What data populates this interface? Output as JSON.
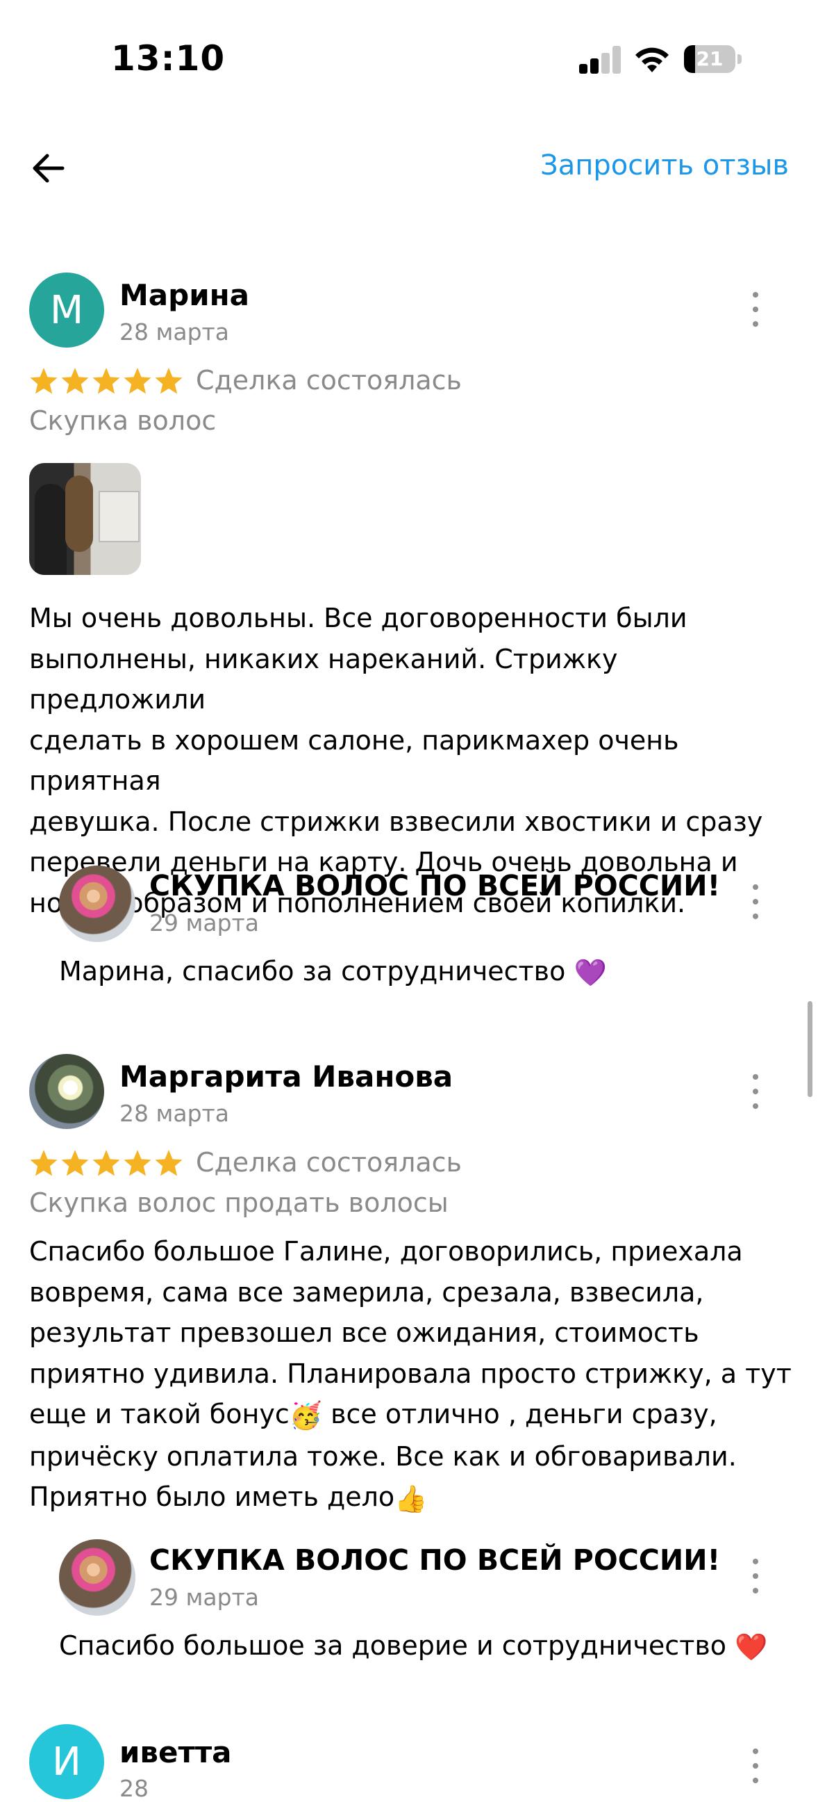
{
  "status_bar": {
    "time": "13:10",
    "battery": "21",
    "battery_level": 0.21
  },
  "header": {
    "request_review": "Запросить отзыв"
  },
  "reviews": [
    {
      "avatar_letter": "М",
      "author": "Марина",
      "date": "28 марта",
      "rating": 5,
      "status": "Сделка состоялась",
      "category": "Скупка волос",
      "lines": [
        "Мы очень довольны. Все договоренности были",
        "выполнены, никаких нареканий. Стрижку предложили",
        "сделать в хорошем салоне, парикмахер очень приятная",
        "девушка. После стрижки взвесили хвостики и сразу",
        "перевели деньги на карту. Дочь очень довольна и",
        "новым образом и пополнением своей копилки."
      ],
      "reply": {
        "author": "СКУПКА ВОЛОС ПО ВСЕЙ РОССИИ!",
        "date": "29 марта",
        "text": "Марина, спасибо за сотрудничество",
        "emoji": "💜"
      }
    },
    {
      "author": "Маргарита Иванова",
      "date": "28 марта",
      "rating": 5,
      "status": "Сделка состоялась",
      "category": "Скупка волос продать волосы",
      "lines": [
        "Спасибо большое Галине, договорились, приехала",
        "вовремя, сама все замерила, срезала, взвесила,",
        "результат превзошел все ожидания, стоимость",
        "приятно удивила. Планировала просто стрижку, а тут",
        "еще и такой бонус",
        " все отлично , деньги сразу,",
        "причёску оплатила тоже. Все как и обговаривали.",
        "Приятно было иметь дело"
      ],
      "emoji_party": "🥳",
      "emoji_thumb": "👍",
      "reply": {
        "author": "СКУПКА ВОЛОС ПО ВСЕЙ РОССИИ!",
        "date": "29 марта",
        "text": "Спасибо большое за доверие и сотрудничество",
        "emoji": "❤️"
      }
    },
    {
      "avatar_letter": "И",
      "author": "иветта",
      "date": "28"
    }
  ],
  "colors": {
    "accent": "#1a97e8",
    "star": "#f5b324",
    "avatar_m": "#26a69a",
    "avatar_i": "#26c6da"
  }
}
